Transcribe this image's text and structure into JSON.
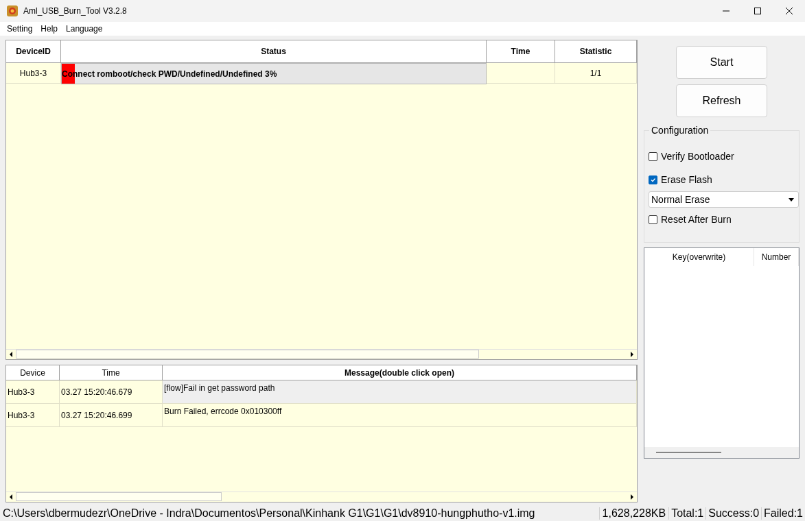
{
  "window": {
    "title": "Aml_USB_Burn_Tool V3.2.8"
  },
  "menu": [
    "Setting",
    "Help",
    "Language"
  ],
  "device_table": {
    "columns": [
      "DeviceID",
      "Status",
      "Time",
      "Statistic"
    ],
    "rows": [
      {
        "device_id": "Hub3-3",
        "status": "Connect romboot/check PWD/Undefined/Undefined 3%",
        "level": 0.03,
        "statistic": "1/1"
      }
    ]
  },
  "log_table": {
    "columns": [
      {
        "label": "Device",
        "emphasized": false
      },
      {
        "label": "Time",
        "emphasized": false
      },
      {
        "label": "Message(double click open)",
        "emphasized": true
      }
    ],
    "rows": [
      {
        "device": "Hub3-3",
        "time": "03.27 15:20:46.679",
        "message": "[flow]Fail in get password path",
        "selected": true
      },
      {
        "device": "Hub3-3",
        "time": "03.27 15:20:46.699",
        "message": "Burn Failed, errcode 0x010300ff",
        "selected": false
      }
    ]
  },
  "buttons": [
    "Start",
    "Refresh"
  ],
  "configuration": {
    "title": "Configuration",
    "options": [
      {
        "kind": "checkbox",
        "label": "Verify Bootloader",
        "checked": false
      },
      {
        "kind": "checkbox",
        "label": "Erase Flash",
        "checked": true
      },
      {
        "kind": "dropdown",
        "value": "Normal Erase"
      },
      {
        "kind": "checkbox",
        "label": "Reset After Burn",
        "checked": false
      }
    ]
  },
  "key_table": {
    "columns": [
      "Key(overwrite)",
      "Number"
    ]
  },
  "status_bar": {
    "path": "C:\\Users\\dbermudezr\\OneDrive - Indra\\Documentos\\Personal\\Kinhank G1\\G1\\G1\\dv8910-hungphutho-v1.img",
    "size": "1,628,228KB",
    "total": "Total:1",
    "success": "Success:0",
    "failed": "Failed:1"
  }
}
